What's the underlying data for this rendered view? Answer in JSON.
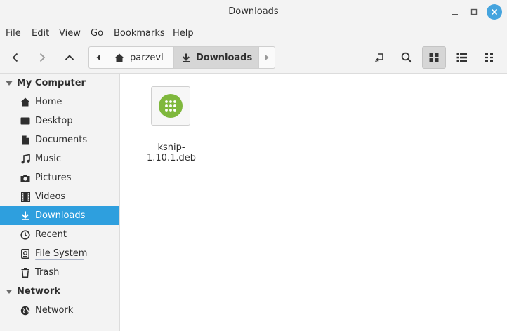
{
  "window": {
    "title": "Downloads"
  },
  "menubar": {
    "items": [
      "File",
      "Edit",
      "View",
      "Go",
      "Bookmarks",
      "Help"
    ]
  },
  "pathbar": {
    "crumbs": [
      "parzevl",
      "Downloads"
    ]
  },
  "sidebar": {
    "sections": [
      {
        "header": "My Computer",
        "items": [
          {
            "label": "Home",
            "icon": "home-icon"
          },
          {
            "label": "Desktop",
            "icon": "desktop-icon"
          },
          {
            "label": "Documents",
            "icon": "document-icon"
          },
          {
            "label": "Music",
            "icon": "music-icon"
          },
          {
            "label": "Pictures",
            "icon": "camera-icon"
          },
          {
            "label": "Videos",
            "icon": "film-icon"
          },
          {
            "label": "Downloads",
            "icon": "download-icon",
            "selected": true
          },
          {
            "label": "Recent",
            "icon": "clock-icon"
          },
          {
            "label": "File System",
            "icon": "drive-icon"
          },
          {
            "label": "Trash",
            "icon": "trash-icon"
          }
        ]
      },
      {
        "header": "Network",
        "items": [
          {
            "label": "Network",
            "icon": "globe-icon"
          }
        ]
      }
    ]
  },
  "files": [
    {
      "name": "ksnip-1.10.1.deb",
      "icon": "package-icon"
    }
  ],
  "colors": {
    "accent": "#2e9fde",
    "close_button": "#45a4de",
    "package_icon": "#7fb83d"
  }
}
